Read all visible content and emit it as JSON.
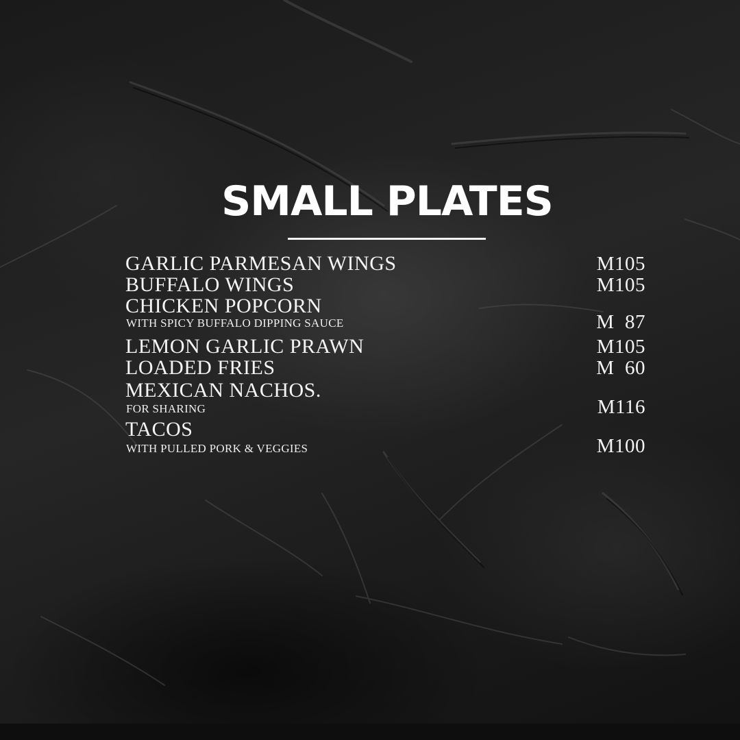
{
  "menu": {
    "title": "SMALL PLATES",
    "items": [
      {
        "name": "GARLIC PARMESAN WINGS",
        "note": "",
        "price": "M105"
      },
      {
        "name": "BUFFALO WINGS",
        "note": "",
        "price": "M105"
      },
      {
        "name": "CHICKEN POPCORN",
        "note": "WITH SPICY BUFFALO DIPPING SAUCE",
        "price": "M  87"
      },
      {
        "name": "LEMON GARLIC PRAWN",
        "note": "",
        "price": "M105"
      },
      {
        "name": "LOADED FRIES",
        "note": "",
        "price": "M  60"
      },
      {
        "name": "MEXICAN NACHOS.",
        "note": "FOR SHARING",
        "price": "M116"
      },
      {
        "name": "TACOS",
        "note": "WITH PULLED PORK & VEGGIES",
        "price": "M100"
      }
    ]
  },
  "colors": {
    "background": "#141414",
    "text": "#ffffff"
  }
}
